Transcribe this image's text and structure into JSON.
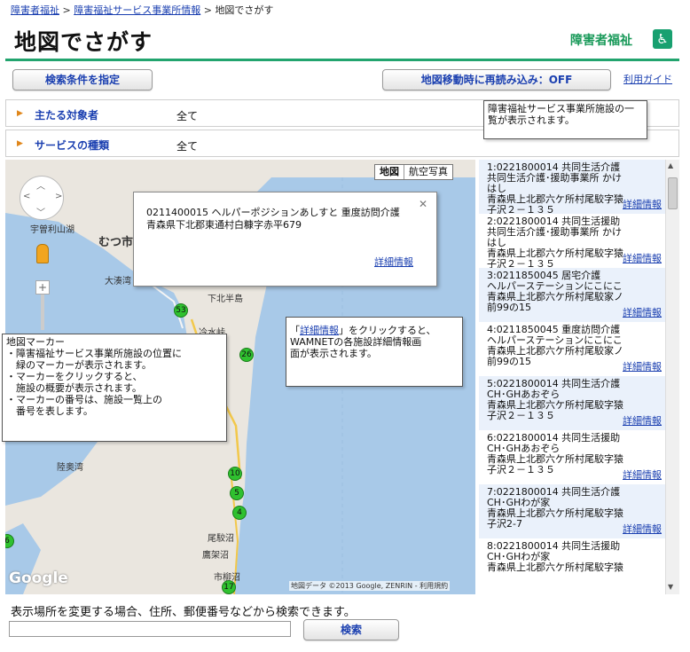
{
  "breadcrumb": {
    "home": "障害者福祉",
    "section": "障害福祉サービス事業所情報",
    "sep1": " > ",
    "sep2": " > ",
    "current": "地図でさがす"
  },
  "page": {
    "title": "地図でさがす",
    "brand": "障害者福祉",
    "brand_icon": "wheelchair-icon",
    "accent": "#22a46e"
  },
  "toolbar": {
    "search_conditions": "検索条件を指定",
    "reload_toggle": "地図移動時に再読み込み：OFF",
    "guide_link": "利用ガイド"
  },
  "filters": [
    {
      "label": "主たる対象者",
      "value": "全て"
    },
    {
      "label": "サービスの種類",
      "value": "全て"
    }
  ],
  "map": {
    "type_map": "地図",
    "type_satellite": "航空写真",
    "copyright": "地図データ ©2013 Google, ZENRIN - 利用規約",
    "google_logo": "Google",
    "place_labels": [
      "宇曽利山湖",
      "むつ市",
      "大湊湾",
      "下北半島",
      "冷水峠",
      "陸奥湾",
      "尾駮沼",
      "鷹架沼",
      "市柳沼"
    ],
    "markers": [
      "53",
      "26",
      "10",
      "5",
      "4",
      "17",
      "6"
    ],
    "popup": {
      "line1": "0211400015 ヘルパーポジションあしすと 重度訪問介護",
      "line2": "青森県下北郡東通村白糠字赤平679",
      "details_link": "詳細情報"
    }
  },
  "callouts": {
    "list_hint": "障害福祉サービス事業所施設の一覧が表示されます。",
    "marker_title": "地図マーカー",
    "marker_1": "・障害福祉サービス事業所施設の位置に",
    "marker_1b": "　緑のマーカーが表示されます。",
    "marker_2": "・マーカーをクリックすると、",
    "marker_2b": "　施設の概要が表示されます。",
    "marker_3": "・マーカーの番号は、施設一覧上の",
    "marker_3b": "　番号を表します。",
    "detail_link_word": "詳細情報",
    "detail_rest": "」をクリックすると、",
    "detail_line2": "WAMNETの各施設詳細情報画",
    "detail_line3": "面が表示されます。",
    "detail_open_quote": "「"
  },
  "facilities": [
    {
      "line1": "1:0221800014 共同生活介護",
      "line2": "共同生活介護･援助事業所 かけ",
      "line3": "はし",
      "line4": "青森県上北郡六ケ所村尾駮字猿",
      "line5": "子沢２－１３５",
      "link": "詳細情報"
    },
    {
      "line1": "2:0221800014 共同生活援助",
      "line2": "共同生活介護･援助事業所 かけ",
      "line3": "はし",
      "line4": "青森県上北郡六ケ所村尾駮字猿",
      "line5": "子沢２－１３５",
      "link": "詳細情報"
    },
    {
      "line1": "3:0211850045 居宅介護",
      "line2": "ヘルパーステーションにこにこ",
      "line3": "青森県上北郡六ケ所村尾駮家ノ",
      "line4": "前99の15",
      "line5": "",
      "link": "詳細情報"
    },
    {
      "line1": "4:0211850045 重度訪問介護",
      "line2": "ヘルパーステーションにこにこ",
      "line3": "青森県上北郡六ケ所村尾駮家ノ",
      "line4": "前99の15",
      "line5": "",
      "link": "詳細情報"
    },
    {
      "line1": "5:0221800014 共同生活介護",
      "line2": "CH･GHあおぞら",
      "line3": "青森県上北郡六ケ所村尾駮字猿",
      "line4": "子沢２－１３５",
      "line5": "",
      "link": "詳細情報"
    },
    {
      "line1": "6:0221800014 共同生活援助",
      "line2": "CH･GHあおぞら",
      "line3": "青森県上北郡六ケ所村尾駮字猿",
      "line4": "子沢２－１３５",
      "line5": "",
      "link": "詳細情報"
    },
    {
      "line1": "7:0221800014 共同生活介護",
      "line2": "CH･GHわが家",
      "line3": "青森県上北郡六ケ所村尾駮字猿",
      "line4": "子沢2-7",
      "line5": "",
      "link": "詳細情報"
    },
    {
      "line1": "8:0221800014 共同生活援助",
      "line2": "CH･GHわが家",
      "line3": "青森県上北郡六ケ所村尾駮字猿",
      "line4": "",
      "line5": "",
      "link": ""
    }
  ],
  "search": {
    "label": "表示場所を変更する場合、住所、郵便番号などから検索できます。",
    "value": "",
    "button": "検索"
  }
}
